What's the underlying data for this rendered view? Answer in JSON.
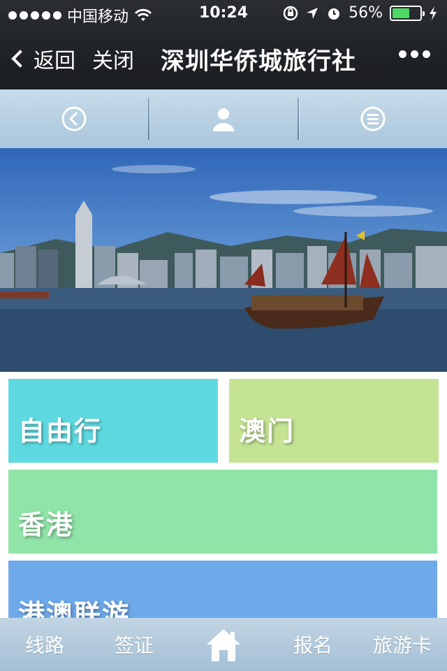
{
  "status_bar": {
    "carrier": "中国移动",
    "time": "10:24",
    "battery_percent": "56%",
    "battery_level": 0.56,
    "icons": [
      "signal-dots",
      "wifi-icon",
      "rotation-lock-icon",
      "location-arrow-icon",
      "alarm-icon",
      "battery-icon",
      "charging-icon"
    ]
  },
  "nav": {
    "back_label": "返回",
    "close_label": "关闭",
    "title": "深圳华侨城旅行社",
    "more_icon": "more-icon"
  },
  "toolbar": {
    "items": [
      {
        "icon": "back-circle-icon"
      },
      {
        "icon": "user-icon"
      },
      {
        "icon": "menu-circle-icon"
      }
    ]
  },
  "banner": {
    "image": "hong-kong-harbor-junk-boat"
  },
  "tiles": [
    {
      "label": "自由行",
      "color": "#5ed9e0"
    },
    {
      "label": "澳门",
      "color": "#c4e494"
    },
    {
      "label": "香港",
      "color": "#90e4a8"
    },
    {
      "label": "港澳联游",
      "color": "#6eaaea"
    }
  ],
  "tabbar": {
    "items": [
      {
        "label": "线路"
      },
      {
        "label": "签证"
      },
      {
        "label": "",
        "icon": "home-icon"
      },
      {
        "label": "报名"
      },
      {
        "label": "旅游卡"
      }
    ]
  }
}
